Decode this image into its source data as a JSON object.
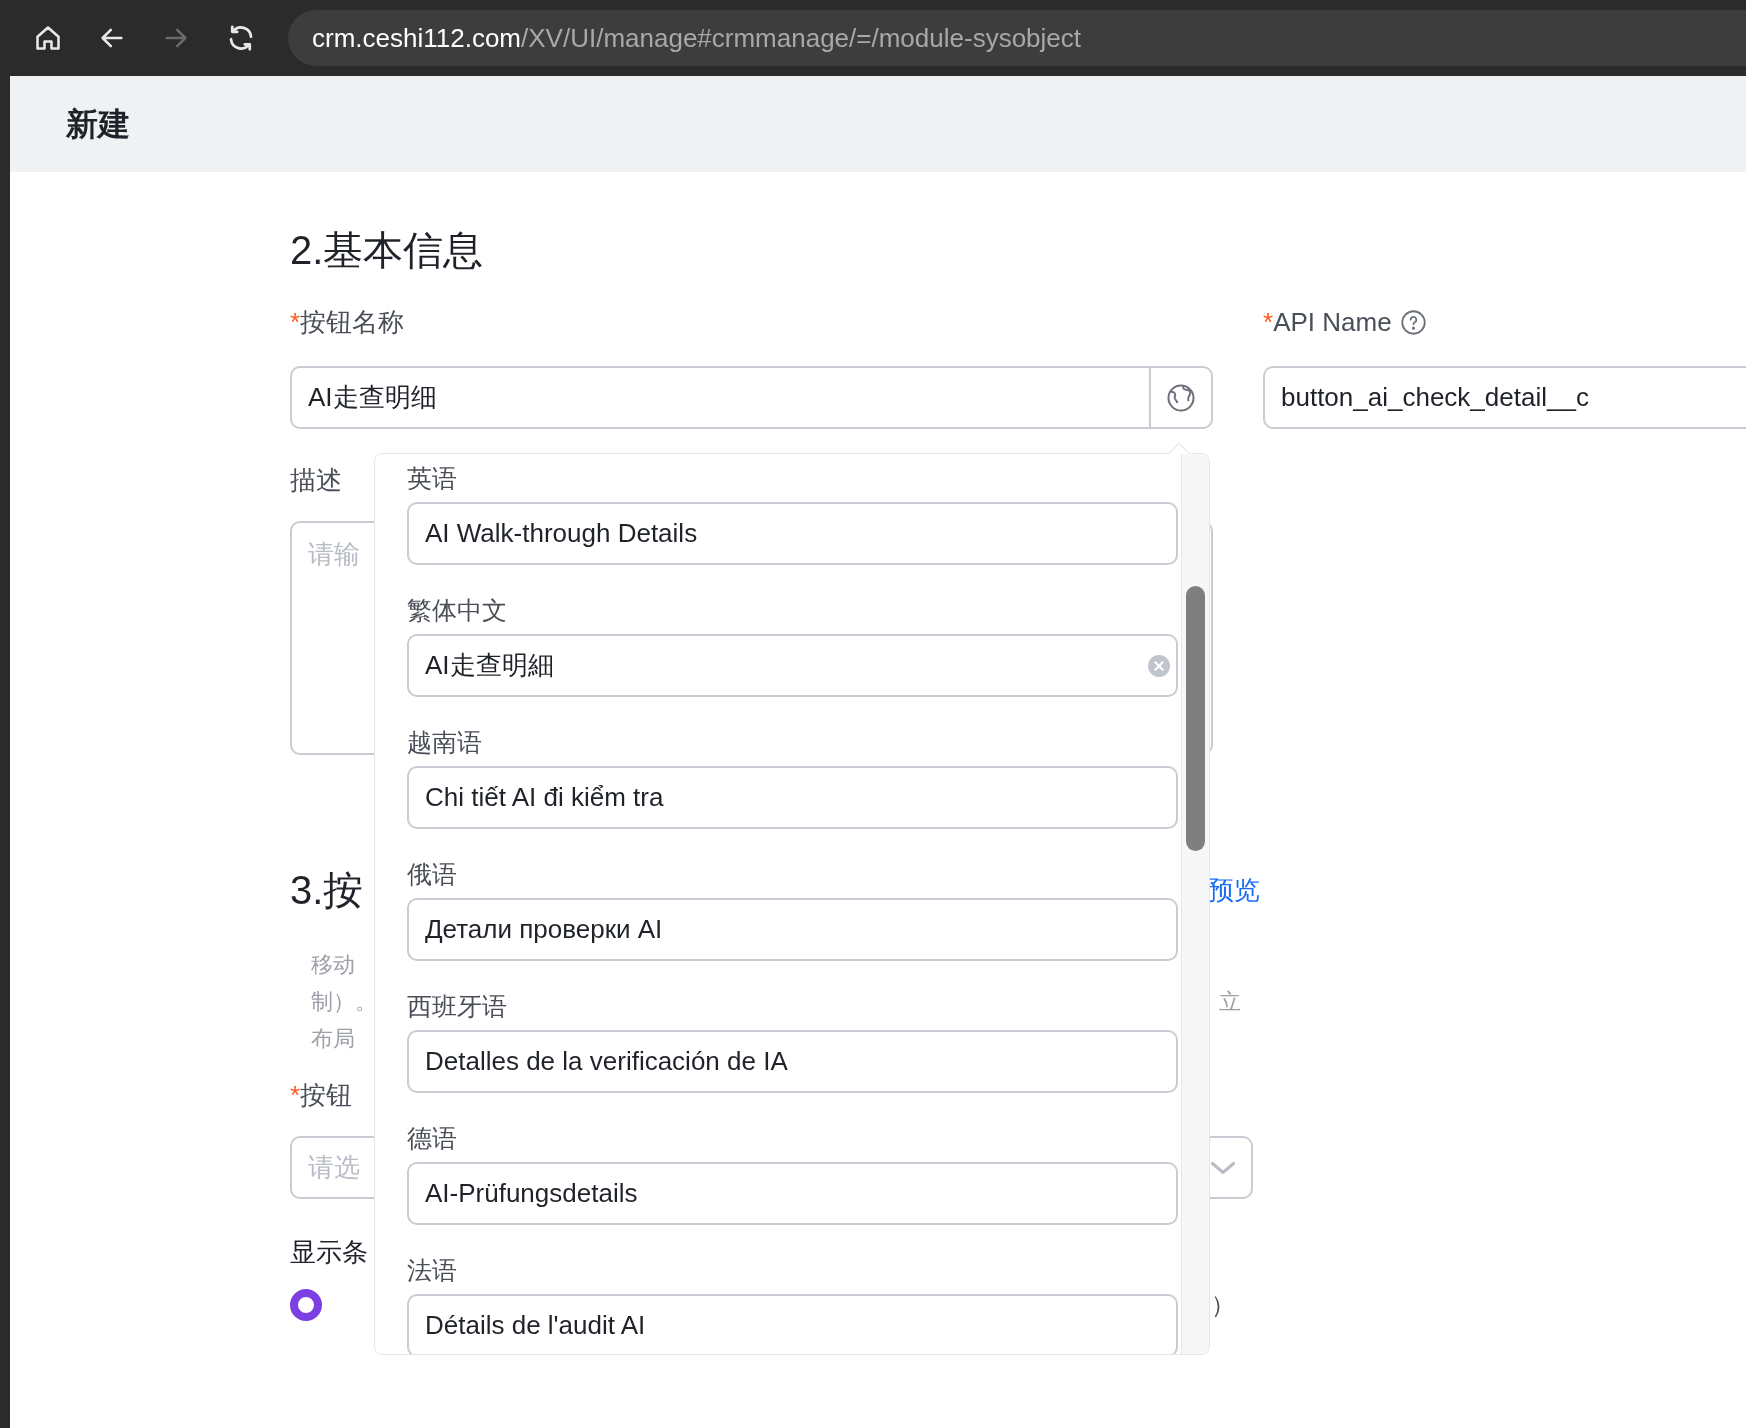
{
  "browser": {
    "url_host": "crm.ceshi112.com",
    "url_path": "/XV/UI/manage#crmmanage/=/module-sysobject",
    "forward_disabled": true
  },
  "page_title": "新建",
  "section_2": {
    "title": "2.基本信息",
    "button_name": {
      "required_mark": "*",
      "label": "按钮名称",
      "value": "AI走查明细"
    },
    "api_name": {
      "required_mark": "*",
      "label": "API Name",
      "value": "button_ai_check_detail__c"
    },
    "description": {
      "label": "描述",
      "placeholder": "请输"
    }
  },
  "section_3": {
    "title": "3.按",
    "preview_link": "预览",
    "hint_lines": [
      {
        "text": "移动"
      },
      {
        "text": "制）。",
        "tail": "立"
      },
      {
        "text": "布局"
      }
    ],
    "position_field": {
      "required_mark": "*",
      "label": "按钮",
      "placeholder": "请选"
    },
    "display_condition": {
      "label": "显示条",
      "radio_selected": true,
      "tail": "）"
    }
  },
  "translation_popup": {
    "languages": [
      {
        "label": "英语",
        "value": "AI Walk-through Details",
        "clearable": false
      },
      {
        "label": "繁体中文",
        "value": "AI走查明細",
        "clearable": true
      },
      {
        "label": "越南语",
        "value": "Chi tiết AI đi kiểm tra",
        "clearable": false
      },
      {
        "label": "俄语",
        "value": "Детали проверки AI",
        "clearable": false
      },
      {
        "label": "西班牙语",
        "value": "Detalles de la verificación de IA",
        "clearable": false
      },
      {
        "label": "德语",
        "value": "AI-Prüfungsdetails",
        "clearable": false
      },
      {
        "label": "法语",
        "value": "Détails de l'audit AI",
        "clearable": false
      }
    ]
  }
}
